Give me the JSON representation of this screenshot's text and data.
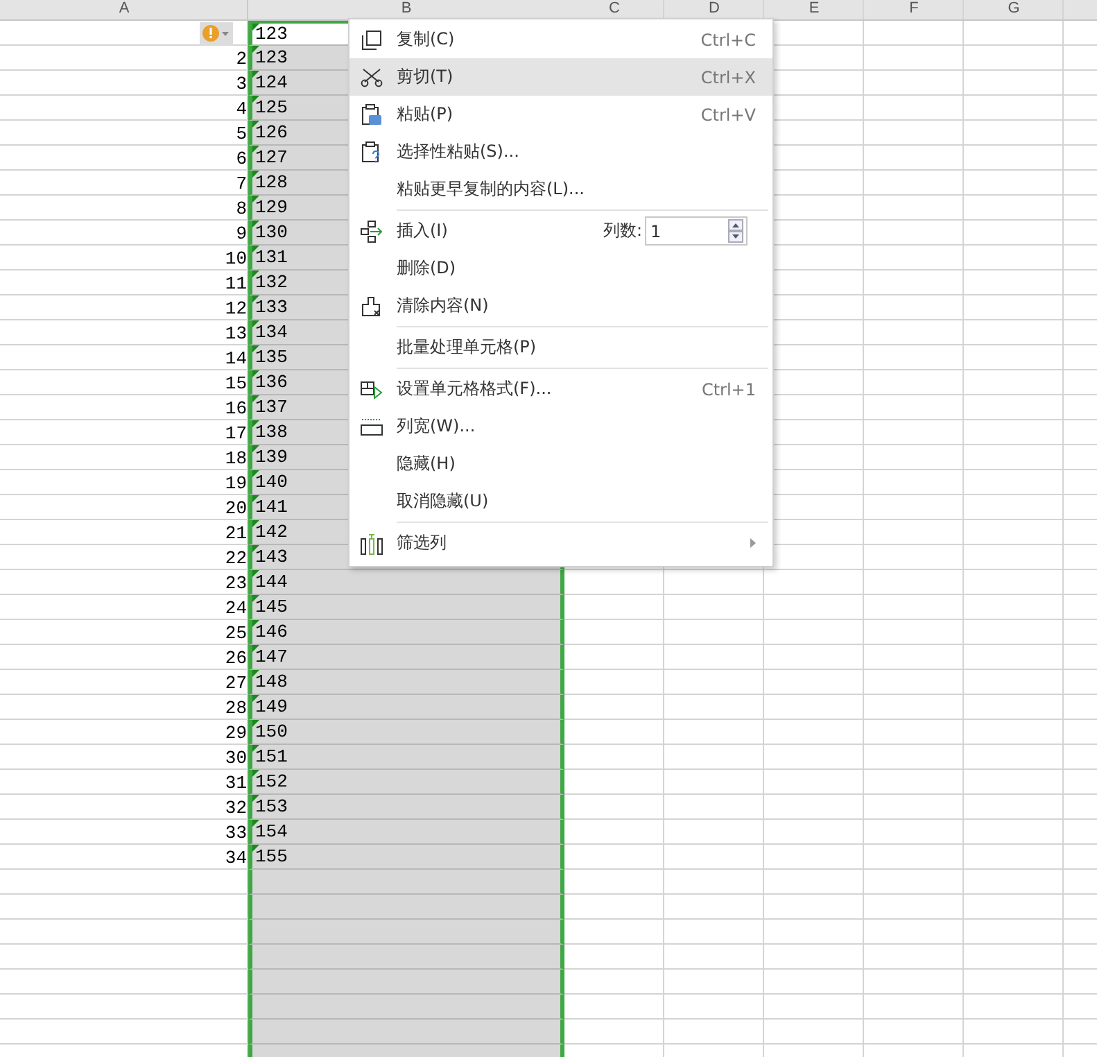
{
  "columns": [
    "A",
    "B",
    "C",
    "D",
    "E",
    "F",
    "G"
  ],
  "rows": [
    {
      "a": "",
      "b": "123",
      "active": true,
      "warning": true,
      "marker": true
    },
    {
      "a": "2",
      "b": "123",
      "active": false,
      "warning": false,
      "marker": true
    },
    {
      "a": "3",
      "b": "124",
      "active": false,
      "warning": false,
      "marker": true
    },
    {
      "a": "4",
      "b": "125",
      "active": false,
      "warning": false,
      "marker": true
    },
    {
      "a": "5",
      "b": "126",
      "active": false,
      "warning": false,
      "marker": true
    },
    {
      "a": "6",
      "b": "127",
      "active": false,
      "warning": false,
      "marker": true
    },
    {
      "a": "7",
      "b": "128",
      "active": false,
      "warning": false,
      "marker": true
    },
    {
      "a": "8",
      "b": "129",
      "active": false,
      "warning": false,
      "marker": true
    },
    {
      "a": "9",
      "b": "130",
      "active": false,
      "warning": false,
      "marker": true
    },
    {
      "a": "10",
      "b": "131",
      "active": false,
      "warning": false,
      "marker": true
    },
    {
      "a": "11",
      "b": "132",
      "active": false,
      "warning": false,
      "marker": true
    },
    {
      "a": "12",
      "b": "133",
      "active": false,
      "warning": false,
      "marker": true
    },
    {
      "a": "13",
      "b": "134",
      "active": false,
      "warning": false,
      "marker": true
    },
    {
      "a": "14",
      "b": "135",
      "active": false,
      "warning": false,
      "marker": true
    },
    {
      "a": "15",
      "b": "136",
      "active": false,
      "warning": false,
      "marker": true
    },
    {
      "a": "16",
      "b": "137",
      "active": false,
      "warning": false,
      "marker": true
    },
    {
      "a": "17",
      "b": "138",
      "active": false,
      "warning": false,
      "marker": true
    },
    {
      "a": "18",
      "b": "139",
      "active": false,
      "warning": false,
      "marker": true
    },
    {
      "a": "19",
      "b": "140",
      "active": false,
      "warning": false,
      "marker": true
    },
    {
      "a": "20",
      "b": "141",
      "active": false,
      "warning": false,
      "marker": true
    },
    {
      "a": "21",
      "b": "142",
      "active": false,
      "warning": false,
      "marker": true
    },
    {
      "a": "22",
      "b": "143",
      "active": false,
      "warning": false,
      "marker": true
    },
    {
      "a": "23",
      "b": "144",
      "active": false,
      "warning": false,
      "marker": true
    },
    {
      "a": "24",
      "b": "145",
      "active": false,
      "warning": false,
      "marker": true
    },
    {
      "a": "25",
      "b": "146",
      "active": false,
      "warning": false,
      "marker": true
    },
    {
      "a": "26",
      "b": "147",
      "active": false,
      "warning": false,
      "marker": true
    },
    {
      "a": "27",
      "b": "148",
      "active": false,
      "warning": false,
      "marker": true
    },
    {
      "a": "28",
      "b": "149",
      "active": false,
      "warning": false,
      "marker": true
    },
    {
      "a": "29",
      "b": "150",
      "active": false,
      "warning": false,
      "marker": true
    },
    {
      "a": "30",
      "b": "151",
      "active": false,
      "warning": false,
      "marker": true
    },
    {
      "a": "31",
      "b": "152",
      "active": false,
      "warning": false,
      "marker": true
    },
    {
      "a": "32",
      "b": "153",
      "active": false,
      "warning": false,
      "marker": true
    },
    {
      "a": "33",
      "b": "154",
      "active": false,
      "warning": false,
      "marker": true
    },
    {
      "a": "34",
      "b": "155",
      "active": false,
      "warning": false,
      "marker": true
    }
  ],
  "context_menu": {
    "items": [
      {
        "kind": "item",
        "label": "复制(C)",
        "shortcut": "Ctrl+C",
        "selected": false
      },
      {
        "kind": "item",
        "label": "剪切(T)",
        "shortcut": "Ctrl+X",
        "selected": true
      },
      {
        "kind": "item",
        "label": "粘贴(P)",
        "shortcut": "Ctrl+V",
        "selected": false
      },
      {
        "kind": "item",
        "label": "选择性粘贴(S)...",
        "selected": false
      },
      {
        "kind": "item",
        "label": "粘贴更早复制的内容(L)...",
        "selected": false
      },
      {
        "kind": "separator"
      },
      {
        "kind": "spin",
        "label": "插入(I)",
        "field_label": "列数:",
        "value": "1",
        "selected": false
      },
      {
        "kind": "item",
        "label": "删除(D)",
        "selected": false
      },
      {
        "kind": "item",
        "label": "清除内容(N)",
        "selected": false
      },
      {
        "kind": "separator"
      },
      {
        "kind": "item",
        "label": "批量处理单元格(P)",
        "selected": false
      },
      {
        "kind": "separator"
      },
      {
        "kind": "item",
        "label": "设置单元格格式(F)...",
        "shortcut": "Ctrl+1",
        "selected": false
      },
      {
        "kind": "item",
        "label": "列宽(W)...",
        "selected": false
      },
      {
        "kind": "item",
        "label": "隐藏(H)",
        "selected": false
      },
      {
        "kind": "item",
        "label": "取消隐藏(U)",
        "selected": false
      },
      {
        "kind": "separator"
      },
      {
        "kind": "item",
        "label": "筛选列",
        "submenu": true,
        "selected": false
      }
    ]
  }
}
